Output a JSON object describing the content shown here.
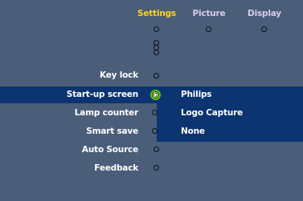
{
  "colors": {
    "background": "#4a5d79",
    "highlight": "#0b3470",
    "active_tab": "#ffd21e",
    "inactive_tab": "#d8ccf0",
    "text": "#ffffff",
    "selection_marker": "#55cc00"
  },
  "tabs": [
    {
      "label": "Settings",
      "active": true
    },
    {
      "label": "Picture",
      "active": false
    },
    {
      "label": "Display",
      "active": false
    }
  ],
  "menu": {
    "items": [
      {
        "label": "Key lock"
      },
      {
        "label": "Start-up screen",
        "selected": true
      },
      {
        "label": "Lamp counter"
      },
      {
        "label": "Smart save"
      },
      {
        "label": "Auto Source"
      },
      {
        "label": "Feedback"
      }
    ]
  },
  "submenu": {
    "items": [
      {
        "label": "Philips"
      },
      {
        "label": "Logo Capture"
      },
      {
        "label": "None"
      }
    ]
  },
  "icons": {
    "selection_marker": "green-ring-arrow-icon",
    "scroll_indicator": "stacked-dots-icon",
    "menu_bullet": "circle-bullet-icon"
  }
}
